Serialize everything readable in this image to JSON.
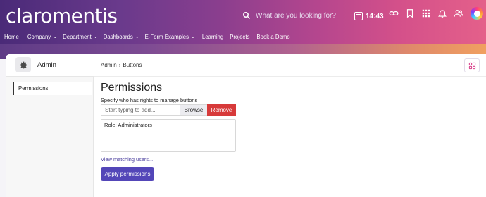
{
  "header": {
    "logo": "claromentis",
    "search_placeholder": "What are you looking for?",
    "time": "14:43",
    "icons": [
      "search-icon",
      "calendar-icon",
      "link-icon",
      "bookmark-icon",
      "apps-grid-icon",
      "bell-icon",
      "people-icon",
      "claromentis-logo-icon"
    ]
  },
  "nav": {
    "items": [
      {
        "label": "Home",
        "has_menu": false
      },
      {
        "label": "Company",
        "has_menu": true,
        "chevron": "⌄"
      },
      {
        "label": "Department",
        "has_menu": true,
        "chevron": "⌄"
      },
      {
        "label": "Dashboards",
        "has_menu": true,
        "chevron": "⌄"
      },
      {
        "label": "E-Form Examples",
        "has_menu": true,
        "chevron": "⌄"
      },
      {
        "label": "Learning",
        "has_menu": false
      },
      {
        "label": "Projects",
        "has_menu": false
      },
      {
        "label": "Book a Demo",
        "has_menu": false
      }
    ]
  },
  "sidebar": {
    "title": "Admin",
    "items": [
      {
        "label": "Permissions",
        "active": true
      }
    ]
  },
  "breadcrumb": {
    "root": "Admin",
    "separator": "›",
    "current": "Buttons"
  },
  "main": {
    "title": "Permissions",
    "description": "Specify who has rights to manage buttons",
    "add_placeholder": "Start typing to add...",
    "browse_label": "Browse",
    "remove_label": "Remove",
    "selected": [
      "Role: Administrators"
    ],
    "view_link": "View matching users...",
    "apply_label": "Apply permissions"
  },
  "colors": {
    "accent": "#5346b8",
    "danger": "#d73a3a",
    "link": "#4b3f9e"
  }
}
